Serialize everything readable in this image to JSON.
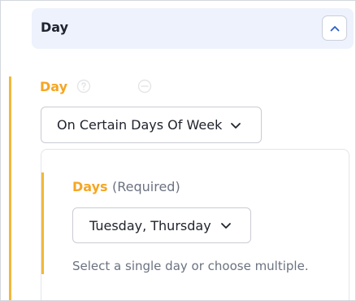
{
  "section": {
    "title": "Day",
    "collapse_icon": "chevron-up-icon"
  },
  "day_field": {
    "label": "Day",
    "help_icon": "question-circle-icon",
    "info_icon": "info-circle-icon",
    "selected_value": "On Certain Days Of Week",
    "dropdown_icon": "chevron-down-icon"
  },
  "days_field": {
    "label": "Days",
    "required_text": "(Required)",
    "selected_value": "Tuesday, Thursday",
    "dropdown_icon": "chevron-down-icon",
    "help_text": "Select a single day or choose multiple."
  },
  "colors": {
    "accent": "#f5a623",
    "header_bg": "#edf2fd",
    "text": "#20242c",
    "muted_text": "#6b7280",
    "border": "#c9ccd3"
  }
}
